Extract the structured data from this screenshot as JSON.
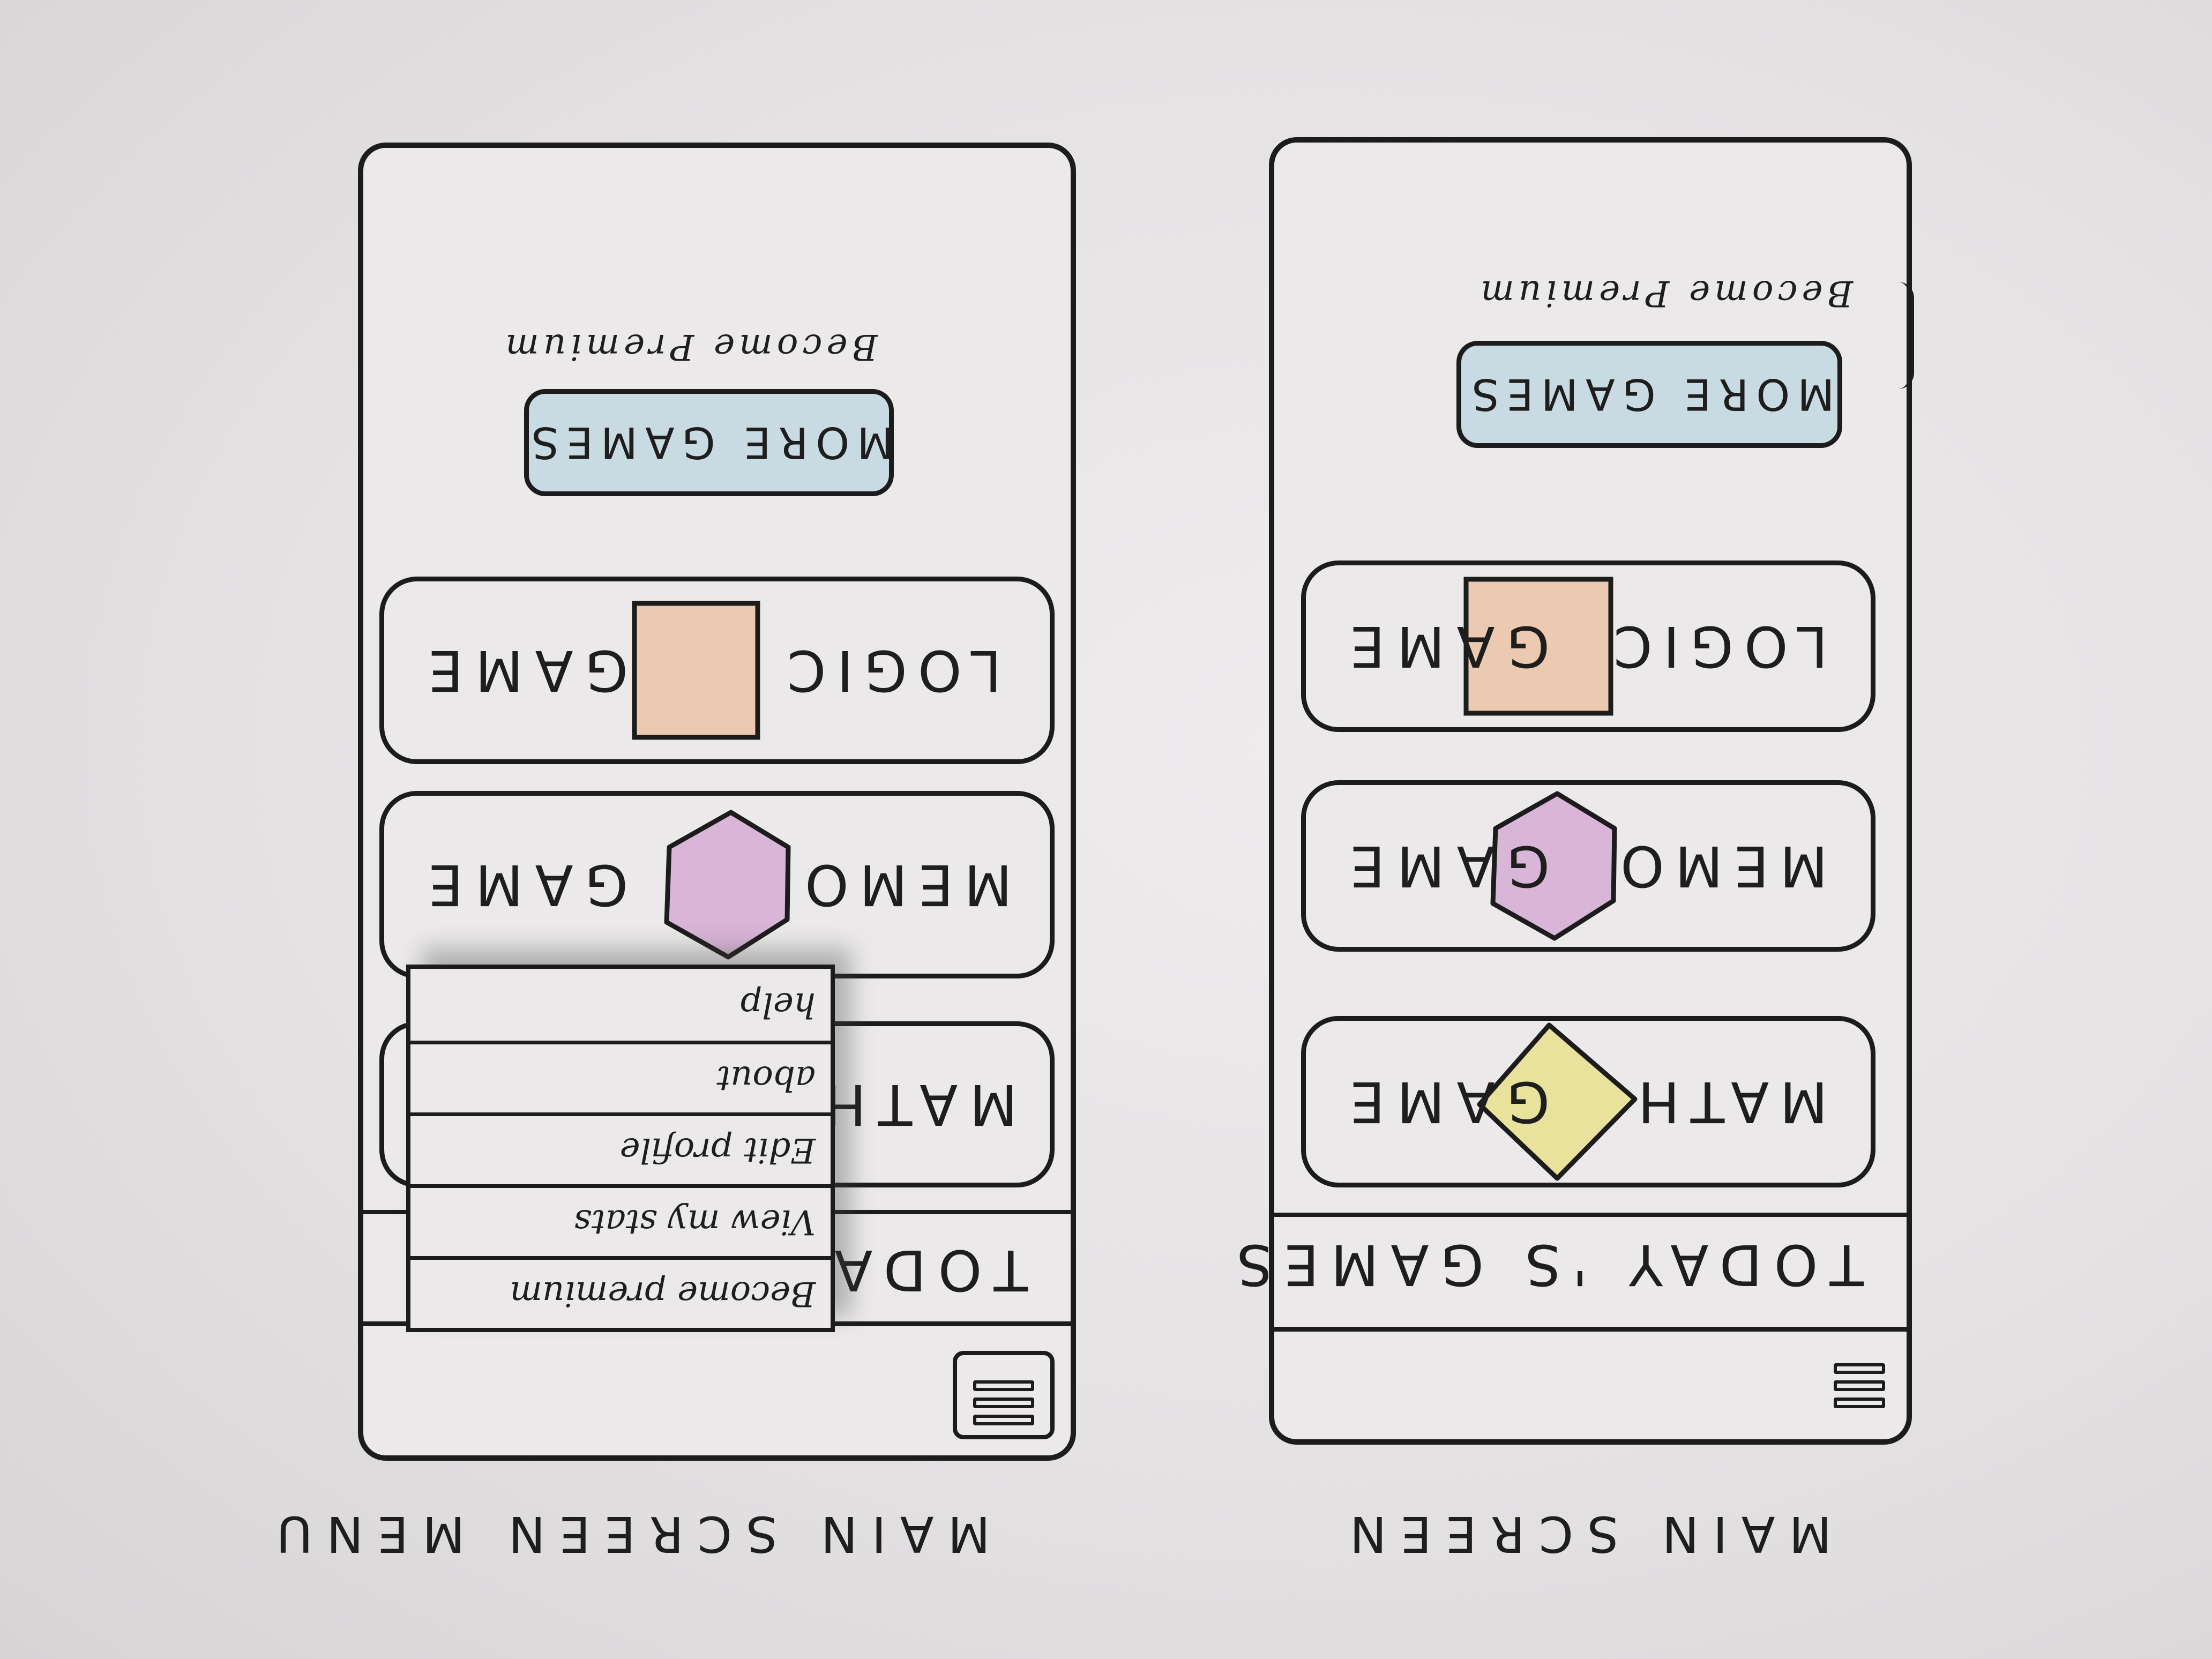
{
  "colors": {
    "paper": "#e8e6e7",
    "ink": "#1c1c1c",
    "math_icon": "#e8e29c",
    "memory_icon": "#d9b5d8",
    "logic_icon": "#ecc9b1",
    "more_games_button": "#c9dbe2"
  },
  "screens": [
    {
      "id": "main-screen",
      "label": "MAIN SCREEN",
      "menu_icon": "hamburger-icon",
      "section_title": "TODAY 'S GAMES",
      "games": [
        {
          "left": "MATH",
          "right": "GAME",
          "icon": "diamond-icon",
          "color": "#e8e29c"
        },
        {
          "left": "MEMORY",
          "right": "GAME",
          "icon": "hexagon-icon",
          "color": "#d9b5d8"
        },
        {
          "left": "LOGIC",
          "right": "GAME",
          "icon": "square-icon",
          "color": "#ecc9b1"
        }
      ],
      "more_games": "MORE GAMES",
      "become_premium": "Become Premium"
    },
    {
      "id": "main-screen-menu",
      "label": "MAIN SCREEN MENU",
      "menu_icon": "hamburger-icon",
      "section_title": "TODAY",
      "games": [
        {
          "left": "",
          "right": "MATH",
          "icon": "",
          "color": ""
        },
        {
          "left": "MEMORY",
          "right": "GAME",
          "icon": "hexagon-icon",
          "color": "#d9b5d8"
        },
        {
          "left": "LOGIC",
          "right": "GAME",
          "icon": "square-icon",
          "color": "#ecc9b1"
        }
      ],
      "more_games": "MORE GAMES",
      "become_premium": "Become Premium",
      "menu_items": [
        "Become premium",
        "View my stats",
        "Edit profile",
        "about",
        "help"
      ]
    }
  ]
}
